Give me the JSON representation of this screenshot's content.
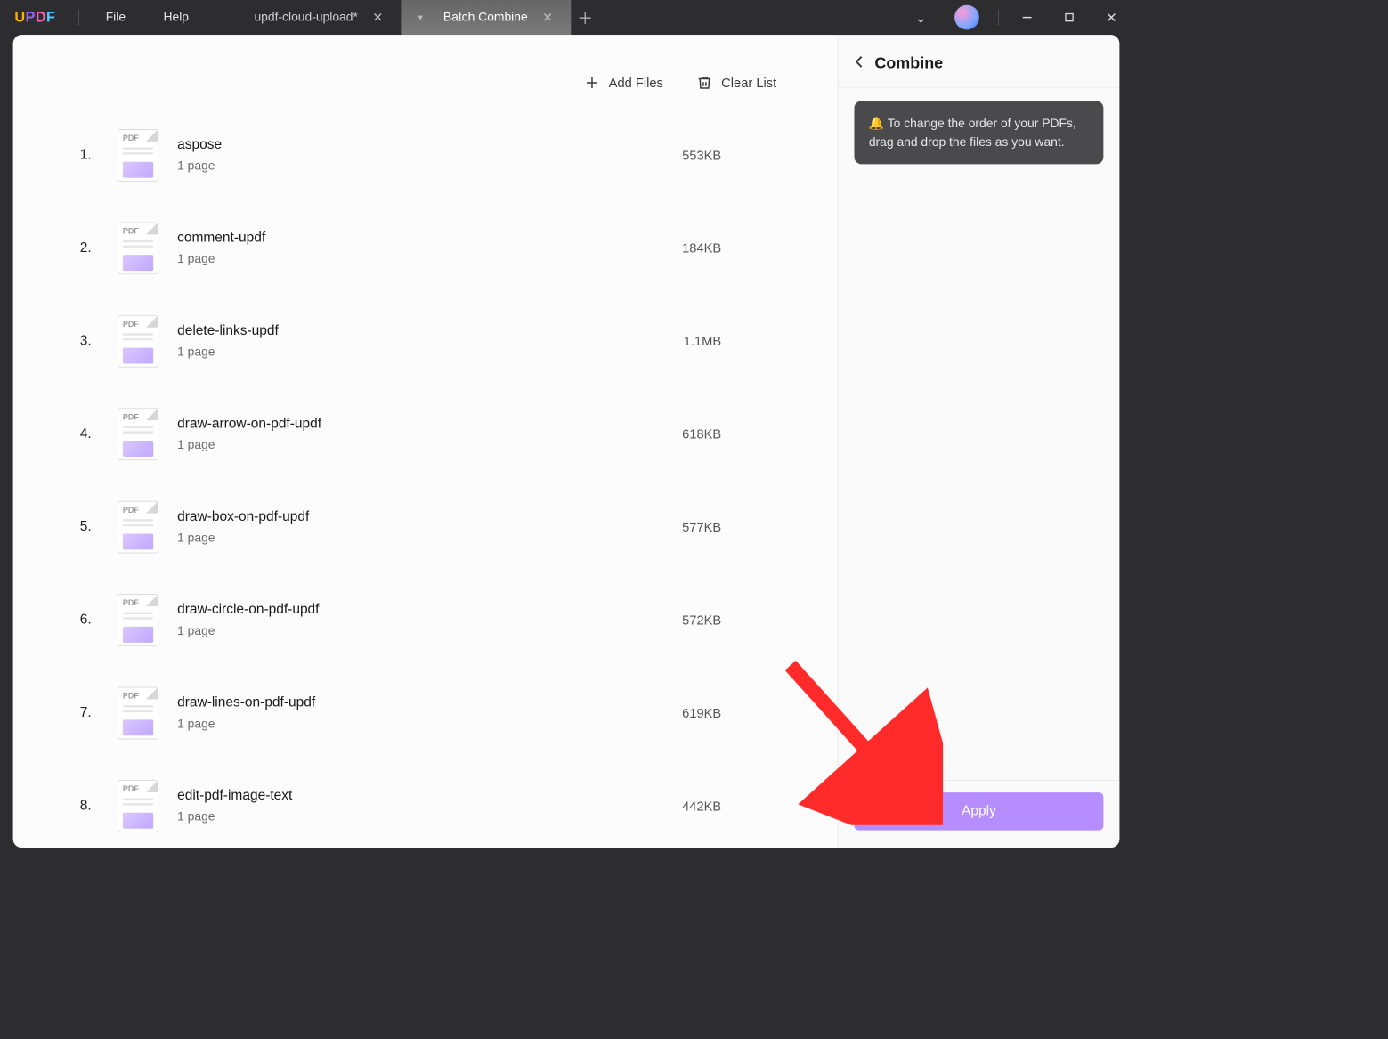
{
  "titlebar": {
    "logo_letters": [
      "U",
      "P",
      "D",
      "F"
    ],
    "menu": {
      "file": "File",
      "help": "Help"
    },
    "tabs": [
      {
        "label": "updf-cloud-upload*",
        "active": false
      },
      {
        "label": "Batch Combine",
        "active": true
      }
    ]
  },
  "toolbar": {
    "add_files": "Add Files",
    "clear_list": "Clear List"
  },
  "files": [
    {
      "name": "aspose",
      "pages": "1 page",
      "size": "553KB"
    },
    {
      "name": "comment-updf",
      "pages": "1 page",
      "size": "184KB"
    },
    {
      "name": "delete-links-updf",
      "pages": "1 page",
      "size": "1.1MB"
    },
    {
      "name": "draw-arrow-on-pdf-updf",
      "pages": "1 page",
      "size": "618KB"
    },
    {
      "name": "draw-box-on-pdf-updf",
      "pages": "1 page",
      "size": "577KB"
    },
    {
      "name": "draw-circle-on-pdf-updf",
      "pages": "1 page",
      "size": "572KB"
    },
    {
      "name": "draw-lines-on-pdf-updf",
      "pages": "1 page",
      "size": "619KB"
    },
    {
      "name": "edit-pdf-image-text",
      "pages": "1 page",
      "size": "442KB"
    }
  ],
  "side": {
    "title": "Combine",
    "tip_icon": "🔔",
    "tip_text": "To change the order of your PDFs, drag and drop the files as you want.",
    "apply": "Apply"
  },
  "icons": {
    "pdf_badge": "PDF"
  }
}
